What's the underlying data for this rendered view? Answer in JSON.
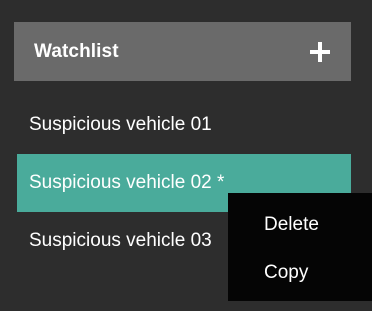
{
  "watchlist": {
    "title": "Watchlist",
    "add_icon": "plus-icon",
    "items": [
      {
        "label": "Suspicious vehicle 01",
        "selected": false
      },
      {
        "label": "Suspicious vehicle 02 *",
        "selected": true
      },
      {
        "label": "Suspicious vehicle 03",
        "selected": false
      }
    ]
  },
  "context_menu": {
    "items": [
      {
        "label": "Delete"
      },
      {
        "label": "Copy"
      }
    ]
  },
  "colors": {
    "background": "#2d2d2d",
    "header": "#6a6a6a",
    "selected": "#4aab9b",
    "menu": "#050505",
    "text": "#ffffff"
  }
}
